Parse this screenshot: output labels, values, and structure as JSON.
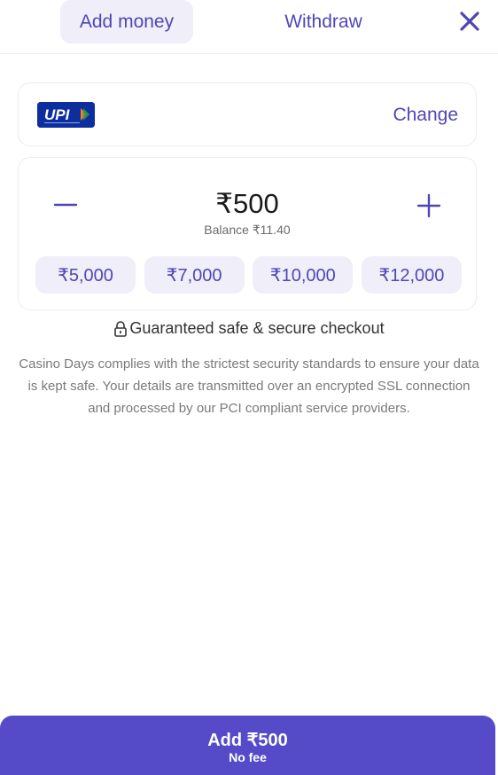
{
  "tabs": [
    {
      "label": "Add money",
      "active": true
    },
    {
      "label": "Withdraw",
      "active": false
    }
  ],
  "header": {
    "close_icon": "close-icon"
  },
  "payment_method": {
    "logo_name": "upi-logo",
    "logo_text": "UPI",
    "change_label": "Change"
  },
  "amount": {
    "value": "₹500",
    "balance": "Balance ₹11.40",
    "presets": [
      "₹5,000",
      "₹7,000",
      "₹10,000",
      "₹12,000"
    ]
  },
  "security": {
    "title": "Guaranteed safe & secure checkout",
    "description": "Casino Days complies with the strictest security standards to ensure your data is kept safe. Your details are transmitted over an encrypted SSL connection and processed by our PCI compliant service providers."
  },
  "submit": {
    "label": "Add ₹500",
    "sub_label": "No fee"
  },
  "colors": {
    "accent": "#554bc8",
    "accent_text": "#4f46b5",
    "chip_bg": "#efeef9",
    "upi_blue": "#0d2e9e"
  }
}
